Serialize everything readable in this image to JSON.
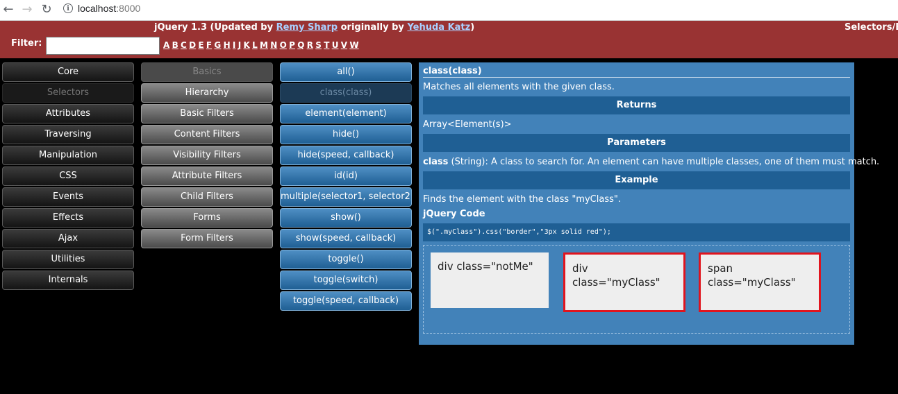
{
  "browser": {
    "url_host": "localhost",
    "url_port": ":8000"
  },
  "header": {
    "title_prefix": "jQuery 1.3 (Updated by ",
    "author1": "Remy Sharp",
    "title_mid": " originally by ",
    "author2": "Yehuda Katz",
    "title_suffix": ")",
    "right_text": "Selectors/E",
    "filter_label": "Filter:",
    "filter_value": "",
    "letters": [
      "A",
      "B",
      "C",
      "D",
      "E",
      "F",
      "G",
      "H",
      "I",
      "J",
      "K",
      "L",
      "M",
      "N",
      "O",
      "P",
      "Q",
      "R",
      "S",
      "T",
      "U",
      "V",
      "W"
    ]
  },
  "categories": [
    {
      "label": "Core",
      "selected": false
    },
    {
      "label": "Selectors",
      "selected": true
    },
    {
      "label": "Attributes",
      "selected": false
    },
    {
      "label": "Traversing",
      "selected": false
    },
    {
      "label": "Manipulation",
      "selected": false
    },
    {
      "label": "CSS",
      "selected": false
    },
    {
      "label": "Events",
      "selected": false
    },
    {
      "label": "Effects",
      "selected": false
    },
    {
      "label": "Ajax",
      "selected": false
    },
    {
      "label": "Utilities",
      "selected": false
    },
    {
      "label": "Internals",
      "selected": false
    }
  ],
  "subcategories": [
    {
      "label": "Basics",
      "selected": true
    },
    {
      "label": "Hierarchy",
      "selected": false
    },
    {
      "label": "Basic Filters",
      "selected": false
    },
    {
      "label": "Content Filters",
      "selected": false
    },
    {
      "label": "Visibility Filters",
      "selected": false
    },
    {
      "label": "Attribute Filters",
      "selected": false
    },
    {
      "label": "Child Filters",
      "selected": false
    },
    {
      "label": "Forms",
      "selected": false
    },
    {
      "label": "Form Filters",
      "selected": false
    }
  ],
  "methods": [
    {
      "label": "all()",
      "selected": false
    },
    {
      "label": "class(class)",
      "selected": true
    },
    {
      "label": "element(element)",
      "selected": false
    },
    {
      "label": "hide()",
      "selected": false
    },
    {
      "label": "hide(speed, callback)",
      "selected": false
    },
    {
      "label": "id(id)",
      "selected": false
    },
    {
      "label": "multiple(selector1, selector2,",
      "selected": false
    },
    {
      "label": "show()",
      "selected": false
    },
    {
      "label": "show(speed, callback)",
      "selected": false
    },
    {
      "label": "toggle()",
      "selected": false
    },
    {
      "label": "toggle(switch)",
      "selected": false
    },
    {
      "label": "toggle(speed, callback)",
      "selected": false
    }
  ],
  "detail": {
    "title": "class(class)",
    "description": "Matches all elements with the given class.",
    "returns_heading": "Returns",
    "returns_value": "Array<Element(s)>",
    "parameters_heading": "Parameters",
    "param_name": "class",
    "param_desc": " (String): A class to search for. An element can have multiple classes, one of them must match.",
    "example_heading": "Example",
    "example_desc": "Finds the element with the class \"myClass\".",
    "code_heading": "jQuery Code",
    "code": "$(\".myClass\").css(\"border\",\"3px solid red\");",
    "demo_boxes": [
      {
        "text": "div class=\"notMe\"",
        "highlighted": false
      },
      {
        "text": "div class=\"myClass\"",
        "highlighted": true
      },
      {
        "text": "span class=\"myClass\"",
        "highlighted": true
      }
    ]
  },
  "colors": {
    "header_bg": "#993333",
    "panel_bg": "#4282b9",
    "bar_bg": "#1f5f94",
    "highlight_border": "#e0141e"
  }
}
